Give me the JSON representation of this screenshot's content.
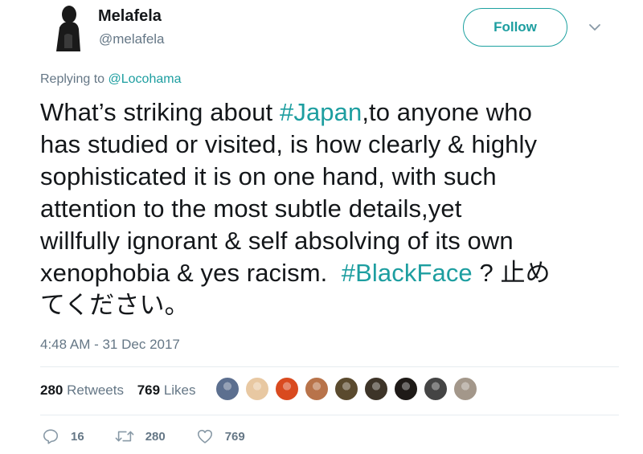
{
  "author": {
    "display_name": "Melafela",
    "handle": "@melafela"
  },
  "follow_button": {
    "label": "Follow"
  },
  "reply_context": {
    "prefix": "Replying to",
    "to": "@Locohama"
  },
  "tweet": {
    "lines": [
      [
        "What’s striking about ",
        "#Japan",
        ",to anyone who"
      ],
      [
        "has studied or visited, is how clearly & highly"
      ],
      [
        "sophisticated it is on one hand, with such"
      ],
      [
        "attention to the most subtle details,yet"
      ],
      [
        "willfully ignorant & self absolving of its own"
      ],
      [
        "xenophobia & yes racism.  ",
        "#BlackFace",
        " ? 止め"
      ],
      [
        "てください。"
      ]
    ],
    "timestamp": "4:48 AM - 31 Dec 2017"
  },
  "stats": {
    "retweets_count": "280",
    "retweets_label": "Retweets",
    "likes_count": "769",
    "likes_label": "Likes"
  },
  "liker_avatars": [
    {
      "color": "#5c6f8f"
    },
    {
      "color": "#e8c8a2"
    },
    {
      "color": "#d94a1f"
    },
    {
      "color": "#b8734a"
    },
    {
      "color": "#5a4a2e"
    },
    {
      "color": "#3d3428"
    },
    {
      "color": "#1e1a17"
    },
    {
      "color": "#444444"
    },
    {
      "color": "#a3978a"
    }
  ],
  "actions": {
    "reply_count": "16",
    "retweet_count": "280",
    "like_count": "769"
  },
  "colors": {
    "accent": "#1d9ea0",
    "muted": "#657786",
    "text": "#14171a"
  }
}
